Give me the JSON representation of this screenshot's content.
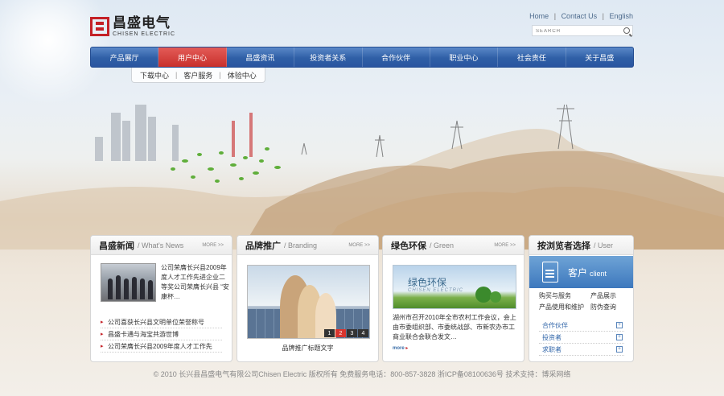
{
  "logo": {
    "cn": "昌盛电气",
    "en": "CHISEN ELECTRIC"
  },
  "toplinks": {
    "home": "Home",
    "contact": "Contact Us",
    "english": "English",
    "sep": "|"
  },
  "search": {
    "placeholder": "SEARCH"
  },
  "nav": {
    "items": [
      "产品展厅",
      "用户中心",
      "昌盛资讯",
      "投资者关系",
      "合作伙伴",
      "职业中心",
      "社会责任",
      "关于昌盛"
    ],
    "active_index": 1
  },
  "subnav": {
    "items": [
      "下载中心",
      "客户服务",
      "体验中心"
    ],
    "sep": "|"
  },
  "panels": {
    "news": {
      "title": "昌盛新闻",
      "sub": "/ What's News",
      "more": "MORE >>",
      "blurb": "公司荣膺长兴县2009年度人才工作先进企业二等奖公司荣膺长兴县 “安康杯…",
      "items": [
        "公司喜获长兴县文明单位荣誉称号",
        "昌盛卡通与海宝共游世博",
        "公司荣膺长兴县2009年度人才工作先"
      ]
    },
    "brand": {
      "title": "品牌推广",
      "sub": "/ Branding",
      "more": "MORE >>",
      "caption": "品牌推广标题文字",
      "pages": [
        "1",
        "2",
        "3",
        "4"
      ],
      "active_page": "2"
    },
    "green": {
      "title": "绿色环保",
      "sub": "/ Green",
      "more": "MORE >>",
      "image_title": "绿色环保",
      "image_sub": "CHISEN ELECTRIC",
      "text": "湖州市召开2010年全市农村工作会议，会上由市委组织部、市委统战部、市新农办市工商业联合会联合发文…",
      "more_link": "more"
    },
    "user": {
      "title": "按浏览者选择",
      "sub": "/ User",
      "client_cn": "客户",
      "client_en": "client",
      "links": [
        "购买与服务",
        "产品展示",
        "产品使用和维护",
        "防伪查询"
      ],
      "visitors": [
        "合作伙伴",
        "投资者",
        "求职者"
      ]
    }
  },
  "footer": "© 2010 长兴县昌盛电气有限公司Chisen Electric 版权所有    免费服务电话：800-857-3828    浙ICP备08100636号    技术支持：博采网络",
  "colors": {
    "nav_blue": "#2f5fa6",
    "nav_active": "#c8302c",
    "brand_red": "#c42026"
  }
}
